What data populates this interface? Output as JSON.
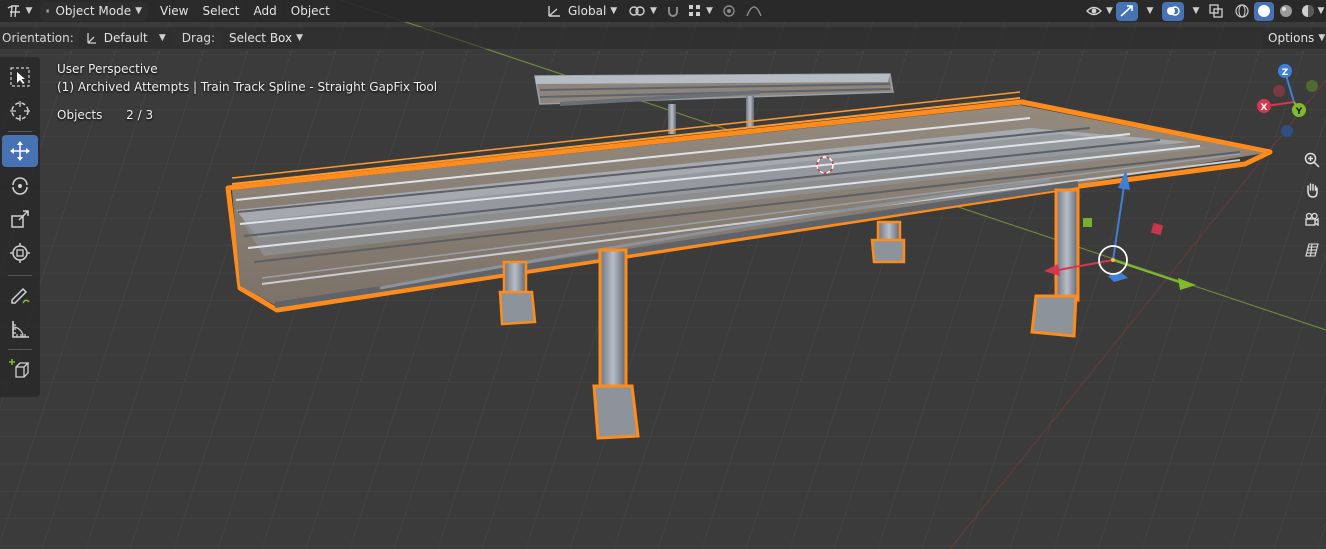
{
  "header": {
    "mode_label": "Object Mode",
    "menus": [
      "View",
      "Select",
      "Add",
      "Object"
    ],
    "transform_orientation": "Global"
  },
  "tool_settings": {
    "orientation_label": "Orientation:",
    "orientation_value": "Default",
    "drag_label": "Drag:",
    "drag_value": "Select Box",
    "options_label": "Options"
  },
  "overlay_info": {
    "view_name": "User Perspective",
    "collection_line": "(1) Archived Attempts | Train Track Spline - Straight GapFix Tool",
    "objects_label": "Objects",
    "objects_count": "2 / 3"
  },
  "gizmo": {
    "x_label": "X",
    "y_label": "Y",
    "z_label": "Z",
    "x_color": "#d7364f",
    "y_color": "#7fbb2c",
    "z_color": "#3f7fd8"
  },
  "colors": {
    "accent": "#4772b3",
    "selection_outline": "#ff8c1a",
    "header_bg": "#282828",
    "grid_bg": "#3d3d3d"
  },
  "toolbar_tools": [
    "select-box-tool",
    "cursor-tool",
    "move-tool",
    "rotate-tool",
    "scale-tool",
    "transform-tool",
    "annotate-tool",
    "measure-tool",
    "add-cube-tool"
  ],
  "navigation_tools": [
    "zoom-icon",
    "pan-hand-icon",
    "camera-view-icon",
    "ortho-grid-icon"
  ]
}
